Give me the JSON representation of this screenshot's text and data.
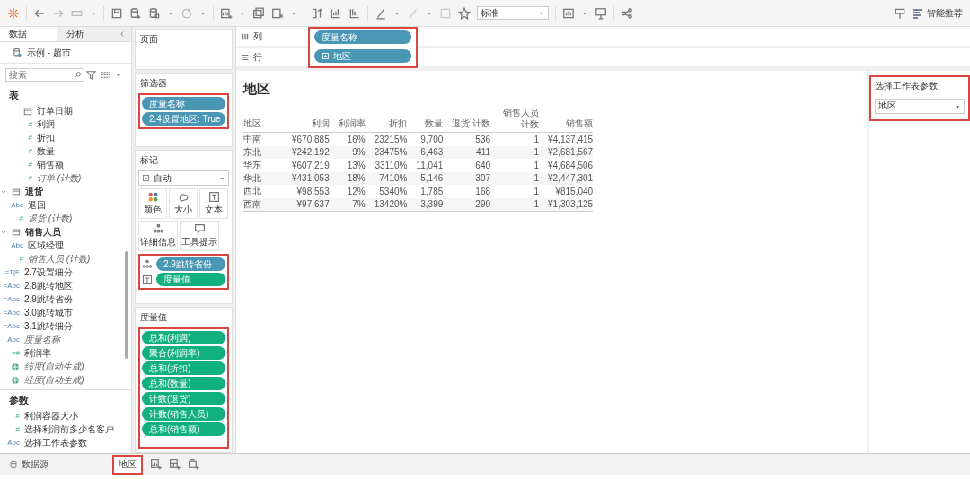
{
  "toolbar": {
    "view_size": "标准",
    "show_me": "智能推荐"
  },
  "data_pane": {
    "tabs": [
      {
        "label": "数据",
        "selected": true
      },
      {
        "label": "分析",
        "selected": false
      }
    ],
    "data_source": "示例 - 超市",
    "search": {
      "placeholder": "搜索"
    },
    "title": "表",
    "fields": [
      {
        "kind": "date",
        "label": "订单日期",
        "italic": false
      },
      {
        "kind": "measure",
        "badge": "#",
        "label": "利润",
        "italic": false
      },
      {
        "kind": "measure",
        "badge": "#",
        "label": "折扣",
        "italic": false
      },
      {
        "kind": "measure",
        "badge": "#",
        "label": "数量",
        "italic": false
      },
      {
        "kind": "measure",
        "badge": "#",
        "label": "销售额",
        "italic": false
      },
      {
        "kind": "measure",
        "badge": "#",
        "label": "订单 (计数)",
        "italic": true
      },
      {
        "kind": "folder",
        "label": "退货",
        "expanded": true,
        "children": [
          {
            "kind": "dimension",
            "badge": "Abc",
            "label": "退回",
            "italic": false
          },
          {
            "kind": "measure",
            "badge": "#",
            "label": "退货 (计数)",
            "italic": true
          }
        ]
      },
      {
        "kind": "folder",
        "label": "销售人员",
        "expanded": true,
        "children": [
          {
            "kind": "dimension",
            "badge": "Abc",
            "label": "区域经理",
            "italic": false
          },
          {
            "kind": "measure",
            "badge": "#",
            "label": "销售人员 (计数)",
            "italic": true
          }
        ]
      },
      {
        "kind": "dimension",
        "badge": "=T|F",
        "label": "2.7设置细分",
        "italic": false
      },
      {
        "kind": "dimension",
        "badge": "=Abc",
        "label": "2.8跳转地区",
        "italic": false
      },
      {
        "kind": "dimension",
        "badge": "=Abc",
        "label": "2.9跳转省份",
        "italic": false
      },
      {
        "kind": "dimension",
        "badge": "=Abc",
        "label": "3.0跳转城市",
        "italic": false
      },
      {
        "kind": "dimension",
        "badge": "=Abc",
        "label": "3.1跳转细分",
        "italic": false
      },
      {
        "kind": "dimension",
        "badge": "Abc",
        "label": "度量名称",
        "italic": true
      },
      {
        "kind": "measure",
        "badge": "=#",
        "label": "利润率",
        "italic": false
      },
      {
        "kind": "geo",
        "label": "纬度(自动生成)",
        "italic": true
      },
      {
        "kind": "geo",
        "label": "经度(自动生成)",
        "italic": true
      }
    ]
  },
  "parameters": {
    "title": "参数",
    "items": [
      {
        "kind": "measure",
        "badge": "#",
        "label": "利润容器大小"
      },
      {
        "kind": "measure",
        "badge": "#",
        "label": "选择利润前多少名客户"
      },
      {
        "kind": "dimension",
        "badge": "Abc",
        "label": "选择工作表参数"
      }
    ]
  },
  "cards": {
    "pages": {
      "title": "页面"
    },
    "filters": {
      "title": "筛选器",
      "highlighted": true,
      "pills": [
        {
          "label": "度量名称",
          "color": "#4a97b5"
        },
        {
          "label": "2.4设置地区: True",
          "color": "#4a97b5"
        }
      ]
    },
    "marks": {
      "title": "标记",
      "mark_type": "自动",
      "buttons": [
        {
          "label": "颜色",
          "kind": "color"
        },
        {
          "label": "大小",
          "kind": "size"
        },
        {
          "label": "文本",
          "kind": "text"
        },
        {
          "label": "详细信息",
          "kind": "detail"
        },
        {
          "label": "工具提示",
          "kind": "tooltip"
        }
      ],
      "highlighted": true,
      "pills": [
        {
          "kind": "detail",
          "label": "2.9跳转省份",
          "color": "#4a97b5"
        },
        {
          "kind": "text",
          "label": "度量值",
          "color": "#12b07f"
        }
      ]
    },
    "measure_values": {
      "title": "度量值",
      "highlighted": true,
      "pills": [
        {
          "label": "总和(利润)",
          "color": "#12b07f"
        },
        {
          "label": "聚合(利润率)",
          "color": "#12b07f"
        },
        {
          "label": "总和(折扣)",
          "color": "#12b07f"
        },
        {
          "label": "总和(数量)",
          "color": "#12b07f"
        },
        {
          "label": "计数(退货)",
          "color": "#12b07f"
        },
        {
          "label": "计数(销售人员)",
          "color": "#12b07f"
        },
        {
          "label": "总和(销售额)",
          "color": "#12b07f"
        }
      ]
    }
  },
  "shelves": {
    "highlighted": true,
    "columns": {
      "label": "列",
      "pills": [
        {
          "label": "度量名称",
          "color": "#4a97b5",
          "expandable": false
        }
      ]
    },
    "rows": {
      "label": "行",
      "pills": [
        {
          "label": "地区",
          "color": "#4a97b5",
          "expandable": true
        }
      ]
    }
  },
  "sheet": {
    "title": "地区",
    "table": {
      "columns": [
        "地区",
        "利润",
        "利润率",
        "折扣",
        "数量",
        "退货 计数",
        "销售人员计数",
        "销售额"
      ],
      "rows": [
        [
          "中南",
          "¥670,885",
          "16%",
          "23215%",
          "9,700",
          "536",
          "1",
          "¥4,137,415"
        ],
        [
          "东北",
          "¥242,192",
          "9%",
          "23475%",
          "6,463",
          "411",
          "1",
          "¥2,681,567"
        ],
        [
          "华东",
          "¥607,219",
          "13%",
          "33110%",
          "11,041",
          "640",
          "1",
          "¥4,684,506"
        ],
        [
          "华北",
          "¥431,053",
          "18%",
          "7410%",
          "5,146",
          "307",
          "1",
          "¥2,447,301"
        ],
        [
          "西北",
          "¥98,553",
          "12%",
          "5340%",
          "1,785",
          "168",
          "1",
          "¥815,040"
        ],
        [
          "西南",
          "¥97,637",
          "7%",
          "13420%",
          "3,399",
          "290",
          "1",
          "¥1,303,125"
        ]
      ]
    }
  },
  "parameter_control": {
    "title": "选择工作表参数",
    "value": "地区",
    "highlighted": true
  },
  "sheet_tabs": {
    "data_source": "数据源",
    "highlighted": true,
    "tabs": [
      {
        "label": "地区",
        "selected": true
      }
    ]
  }
}
